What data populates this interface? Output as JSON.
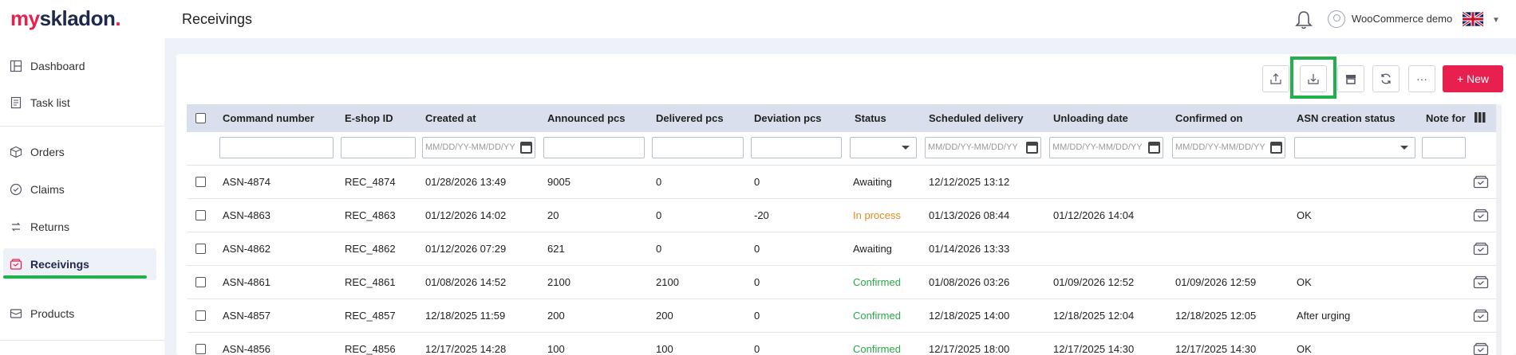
{
  "header": {
    "logo_prefix": "my",
    "logo_main": "skladon",
    "logo_dot": ".",
    "title": "Receivings",
    "user_name": "WooCommerce demo",
    "language_flag": "uk-flag-icon"
  },
  "sidebar": {
    "items": [
      {
        "label": "Dashboard",
        "icon": "dashboard-icon"
      },
      {
        "label": "Task list",
        "icon": "task-list-icon"
      },
      {
        "label": "Orders",
        "icon": "box-icon"
      },
      {
        "label": "Claims",
        "icon": "claims-icon"
      },
      {
        "label": "Returns",
        "icon": "returns-icon"
      },
      {
        "label": "Receivings",
        "icon": "receivings-icon",
        "active": true
      },
      {
        "label": "Products",
        "icon": "products-icon"
      }
    ]
  },
  "toolbar": {
    "export_icon": "upload-icon",
    "import_icon": "download-icon",
    "store_icon": "store-icon",
    "refresh_icon": "refresh-icon",
    "more_label": "···",
    "new_label": "+ New",
    "accent_color": "#e8204f",
    "highlight_color": "#22b04b"
  },
  "table": {
    "columns": [
      "Command number",
      "E-shop ID",
      "Created at",
      "Announced pcs",
      "Delivered pcs",
      "Deviation pcs",
      "Status",
      "Scheduled delivery",
      "Unloading date",
      "Confirmed on",
      "ASN creation status",
      "Note for"
    ],
    "date_placeholder": "MM/DD/YY-MM/DD/YY",
    "rows": [
      {
        "command": "ASN-4874",
        "eshop": "REC_4874",
        "created": "01/28/2026 13:49",
        "announced": "9005",
        "delivered": "0",
        "deviation": "0",
        "status": "Awaiting",
        "scheduled": "12/12/2025 13:12",
        "unloading": "",
        "confirmed": "",
        "asn": ""
      },
      {
        "command": "ASN-4863",
        "eshop": "REC_4863",
        "created": "01/12/2026 14:02",
        "announced": "20",
        "delivered": "0",
        "deviation": "-20",
        "status": "In process",
        "scheduled": "01/13/2026 08:44",
        "unloading": "01/12/2026 14:04",
        "confirmed": "",
        "asn": "OK"
      },
      {
        "command": "ASN-4862",
        "eshop": "REC_4862",
        "created": "01/12/2026 07:29",
        "announced": "621",
        "delivered": "0",
        "deviation": "0",
        "status": "Awaiting",
        "scheduled": "01/14/2026 13:33",
        "unloading": "",
        "confirmed": "",
        "asn": ""
      },
      {
        "command": "ASN-4861",
        "eshop": "REC_4861",
        "created": "01/08/2026 14:52",
        "announced": "2100",
        "delivered": "2100",
        "deviation": "0",
        "status": "Confirmed",
        "scheduled": "01/08/2026 03:26",
        "unloading": "01/09/2026 12:52",
        "confirmed": "01/09/2026 12:59",
        "asn": "OK"
      },
      {
        "command": "ASN-4857",
        "eshop": "REC_4857",
        "created": "12/18/2025 11:59",
        "announced": "200",
        "delivered": "200",
        "deviation": "0",
        "status": "Confirmed",
        "scheduled": "12/18/2025 14:00",
        "unloading": "12/18/2025 12:04",
        "confirmed": "12/18/2025 12:05",
        "asn": "After urging"
      },
      {
        "command": "ASN-4856",
        "eshop": "REC_4856",
        "created": "12/17/2025 14:28",
        "announced": "100",
        "delivered": "100",
        "deviation": "0",
        "status": "Confirmed",
        "scheduled": "12/17/2025 18:00",
        "unloading": "12/17/2025 14:30",
        "confirmed": "12/17/2025 14:30",
        "asn": "OK"
      }
    ]
  }
}
